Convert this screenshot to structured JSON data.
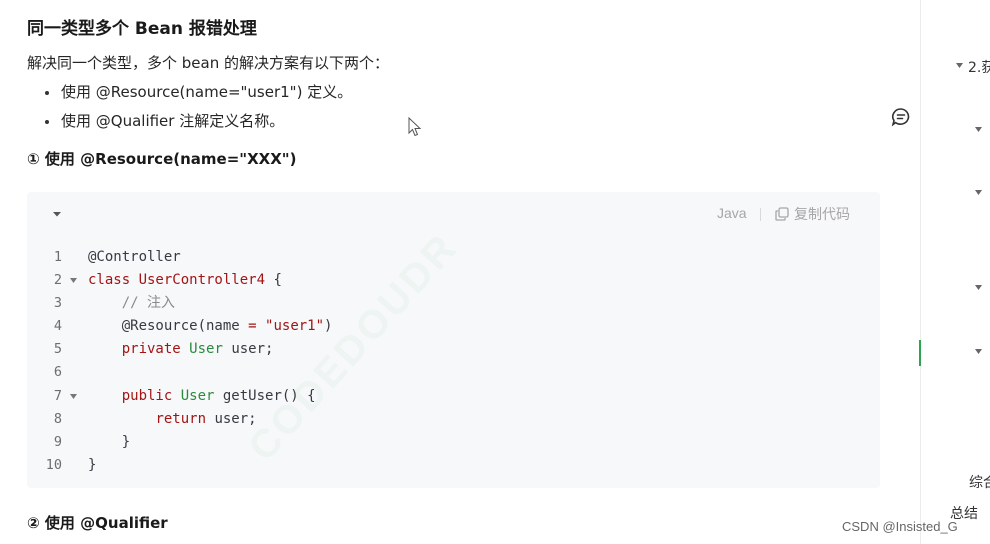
{
  "article": {
    "title": "同一类型多个 Bean 报错处理",
    "intro": "解决同一个类型，多个 bean 的解决方案有以下两个：",
    "bullets": [
      "使用 @Resource(name=\"user1\") 定义。",
      "使用 @Qualifier 注解定义名称。"
    ],
    "section1": "① 使用 @Resource(name=\"XXX\")",
    "section2": "② 使用 @Qualifier"
  },
  "code_block": {
    "language": "Java",
    "copy_label": "复制代码",
    "lines": [
      {
        "n": "1",
        "tokens": [
          {
            "t": "@Controller",
            "c": ""
          }
        ]
      },
      {
        "n": "2",
        "fold": true,
        "tokens": [
          {
            "t": "class ",
            "c": "kw"
          },
          {
            "t": "UserController4",
            "c": "cls"
          },
          {
            "t": " {",
            "c": ""
          }
        ]
      },
      {
        "n": "3",
        "tokens": [
          {
            "t": "    // 注入",
            "c": "cm"
          }
        ]
      },
      {
        "n": "4",
        "tokens": [
          {
            "t": "    @Resource(name ",
            "c": ""
          },
          {
            "t": "=",
            "c": "op"
          },
          {
            "t": " ",
            "c": ""
          },
          {
            "t": "\"user1\"",
            "c": "str"
          },
          {
            "t": ")",
            "c": ""
          }
        ]
      },
      {
        "n": "5",
        "tokens": [
          {
            "t": "    ",
            "c": ""
          },
          {
            "t": "private",
            "c": "kw"
          },
          {
            "t": " ",
            "c": ""
          },
          {
            "t": "User",
            "c": "ty"
          },
          {
            "t": " user;",
            "c": ""
          }
        ]
      },
      {
        "n": "6",
        "tokens": []
      },
      {
        "n": "7",
        "fold": true,
        "tokens": [
          {
            "t": "    ",
            "c": ""
          },
          {
            "t": "public",
            "c": "kw"
          },
          {
            "t": " ",
            "c": ""
          },
          {
            "t": "User",
            "c": "ty"
          },
          {
            "t": " getUser() {",
            "c": ""
          }
        ]
      },
      {
        "n": "8",
        "tokens": [
          {
            "t": "        ",
            "c": ""
          },
          {
            "t": "return",
            "c": "kw"
          },
          {
            "t": " user;",
            "c": ""
          }
        ]
      },
      {
        "n": "9",
        "tokens": [
          {
            "t": "    }",
            "c": ""
          }
        ]
      },
      {
        "n": "10",
        "tokens": [
          {
            "t": "}",
            "c": ""
          }
        ]
      }
    ]
  },
  "toc": {
    "item_top": "2.获",
    "item_zonghe": "综合",
    "item_zongjie": "总结"
  },
  "watermark": "CSDN @Insisted_G",
  "faint_mark": "CODEDOUDR",
  "colors": {
    "accent_green": "#2ea44f",
    "keyword_red": "#a31515",
    "type_green": "#2b8a3e",
    "code_bg": "#f7f8fa"
  }
}
